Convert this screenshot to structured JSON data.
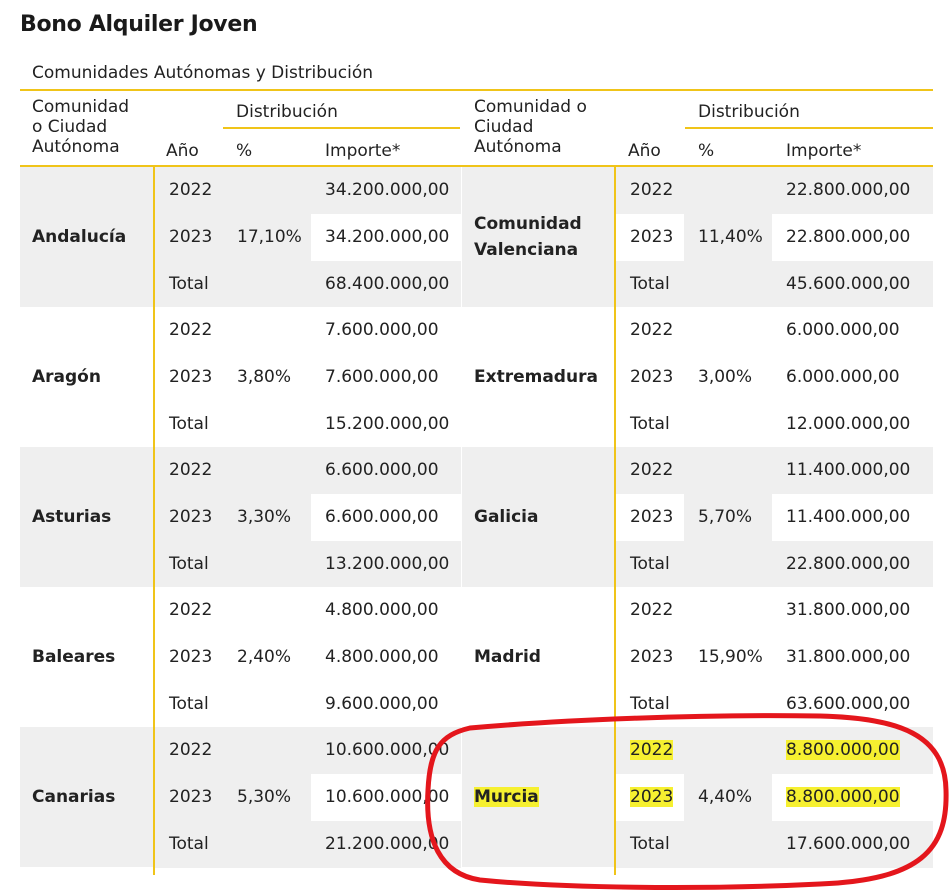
{
  "title": "Bono Alquiler Joven",
  "subtitle": "Comunidades Autónomas y Distribución",
  "headers": {
    "comunidad_l1": "Comunidad",
    "comunidad_l2": "o Ciudad",
    "comunidad_l3": "Autónoma",
    "comunidad_r1": "Comunidad o",
    "comunidad_r2": "Ciudad",
    "comunidad_r3": "Autónoma",
    "distribucion": "Distribución",
    "anio": "Año",
    "pct": "%",
    "importe": "Importe*"
  },
  "rows": [
    {
      "left": {
        "name": "Andalucía",
        "pct": "17,10%",
        "y2022": "34.200.000,00",
        "y2023": "34.200.000,00",
        "total": "68.400.000,00"
      },
      "right": {
        "name_l1": "Comunidad",
        "name_l2": "Valenciana",
        "pct": "11,40%",
        "y2022": "22.800.000,00",
        "y2023": "22.800.000,00",
        "total": "45.600.000,00"
      }
    },
    {
      "left": {
        "name": "Aragón",
        "pct": "3,80%",
        "y2022": "7.600.000,00",
        "y2023": "7.600.000,00",
        "total": "15.200.000,00"
      },
      "right": {
        "name_l1": "Extremadura",
        "name_l2": "",
        "pct": "3,00%",
        "y2022": "6.000.000,00",
        "y2023": "6.000.000,00",
        "total": "12.000.000,00"
      }
    },
    {
      "left": {
        "name": "Asturias",
        "pct": "3,30%",
        "y2022": "6.600.000,00",
        "y2023": "6.600.000,00",
        "total": "13.200.000,00"
      },
      "right": {
        "name_l1": "Galicia",
        "name_l2": "",
        "pct": "5,70%",
        "y2022": "11.400.000,00",
        "y2023": "11.400.000,00",
        "total": "22.800.000,00"
      }
    },
    {
      "left": {
        "name": "Baleares",
        "pct": "2,40%",
        "y2022": "4.800.000,00",
        "y2023": "4.800.000,00",
        "total": "9.600.000,00"
      },
      "right": {
        "name_l1": "Madrid",
        "name_l2": "",
        "pct": "15,90%",
        "y2022": "31.800.000,00",
        "y2023": "31.800.000,00",
        "total": "63.600.000,00"
      }
    },
    {
      "left": {
        "name": "Canarias",
        "pct": "5,30%",
        "y2022": "10.600.000,00",
        "y2023": "10.600.000,00",
        "total": "21.200.000,00"
      },
      "right": {
        "name_l1": "Murcia",
        "name_l2": "",
        "pct": "4,40%",
        "y2022": "8.800.000,00",
        "y2023": "8.800.000,00",
        "total": "17.600.000,00"
      }
    }
  ],
  "labels": {
    "y2022": "2022",
    "y2023": "2023",
    "total": "Total"
  },
  "colors": {
    "accent": "#f0c419",
    "highlight": "#f6f030",
    "annotation": "#e4161c",
    "grey_band": "#efefef"
  }
}
